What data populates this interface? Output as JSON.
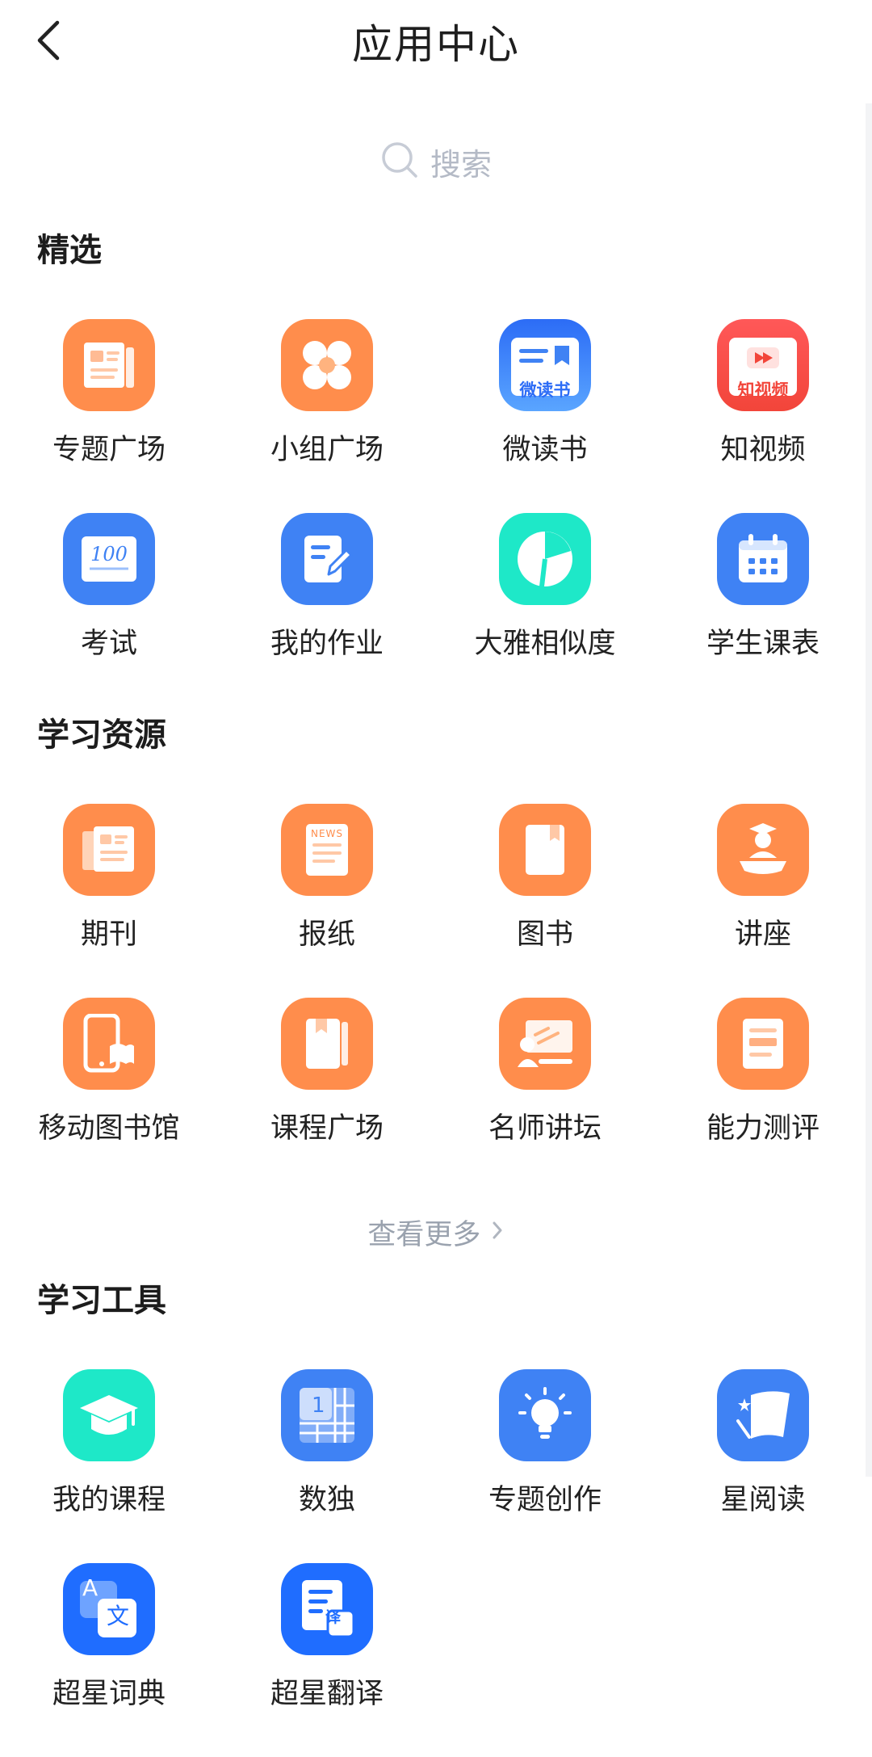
{
  "header": {
    "title": "应用中心"
  },
  "search": {
    "placeholder": "搜索"
  },
  "sections": {
    "featured": {
      "title": "精选",
      "items": [
        {
          "label": "专题广场"
        },
        {
          "label": "小组广场"
        },
        {
          "label": "微读书",
          "icon_text": "微读书"
        },
        {
          "label": "知视频",
          "icon_text": "知视频"
        },
        {
          "label": "考试",
          "icon_text": "100"
        },
        {
          "label": "我的作业"
        },
        {
          "label": "大雅相似度"
        },
        {
          "label": "学生课表"
        }
      ]
    },
    "resources": {
      "title": "学习资源",
      "items": [
        {
          "label": "期刊"
        },
        {
          "label": "报纸",
          "icon_text": "NEWS"
        },
        {
          "label": "图书"
        },
        {
          "label": "讲座"
        },
        {
          "label": "移动图书馆"
        },
        {
          "label": "课程广场"
        },
        {
          "label": "名师讲坛"
        },
        {
          "label": "能力测评"
        }
      ],
      "more_label": "查看更多"
    },
    "tools": {
      "title": "学习工具",
      "items": [
        {
          "label": "我的课程"
        },
        {
          "label": "数独",
          "icon_text": "1"
        },
        {
          "label": "专题创作"
        },
        {
          "label": "星阅读"
        },
        {
          "label": "超星词典",
          "icon_text_a": "A",
          "icon_text_b": "文"
        },
        {
          "label": "超星翻译",
          "icon_text": "译"
        }
      ]
    }
  },
  "colors": {
    "orange": "#ff8d4c",
    "blue": "#3f82f4",
    "teal": "#1ee8c8",
    "red": "#f2453a",
    "muted_text": "#9aa2ae"
  },
  "icons": [
    "chevron-left-icon",
    "search-icon",
    "newspaper-icon",
    "four-circles-icon",
    "book-bookmark-icon",
    "video-play-icon",
    "score-100-icon",
    "edit-note-icon",
    "pie-chart-icon",
    "calendar-icon",
    "journal-icon",
    "news-icon",
    "book-icon",
    "lecturer-icon",
    "mobile-library-icon",
    "course-book-icon",
    "blackboard-icon",
    "assessment-icon",
    "graduation-cap-icon",
    "sudoku-grid-icon",
    "lightbulb-icon",
    "star-reading-icon",
    "dictionary-icon",
    "translate-icon",
    "chevron-right-icon"
  ]
}
